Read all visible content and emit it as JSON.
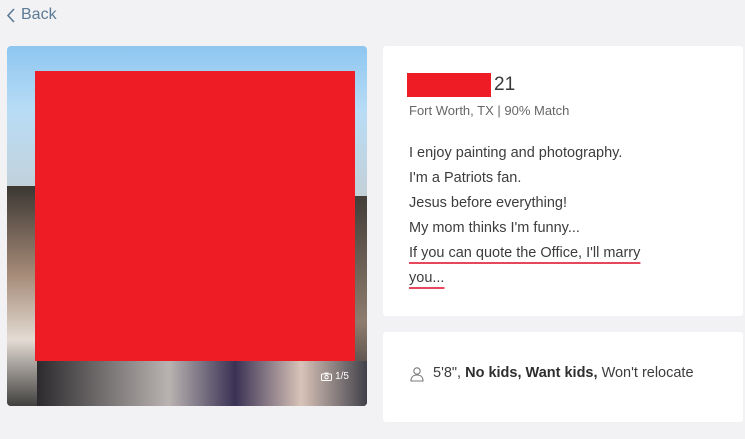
{
  "nav": {
    "back_label": "Back"
  },
  "photo": {
    "count": "1/5"
  },
  "profile": {
    "age": "21",
    "subtitle": "Fort Worth, TX | 90% Match",
    "bio_lines": [
      "I enjoy painting and photography.",
      "I'm a Patriots fan.",
      "Jesus before everything!",
      "My mom thinks I'm funny...",
      "If you can quote the Office, I'll marry",
      "you..."
    ]
  },
  "details": {
    "height": "5'8\",",
    "kids": "No kids,",
    "want": "Want kids,",
    "relocate": "Won't relocate"
  },
  "colors": {
    "accent_underline": "#e6475a",
    "redaction": "#ee1c24",
    "link": "#5b7a95"
  }
}
